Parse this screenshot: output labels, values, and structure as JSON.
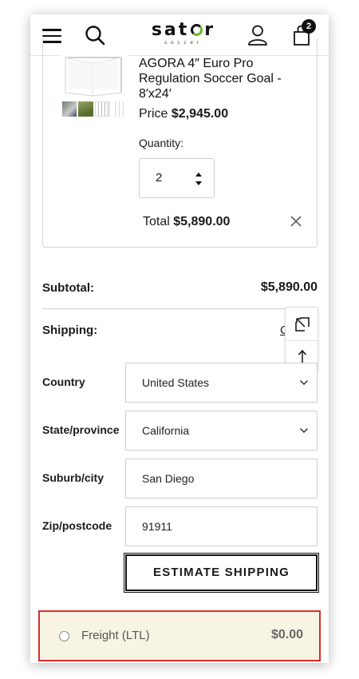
{
  "header": {
    "logo_text": "sator",
    "logo_sub": "soccer",
    "cart_count": "2"
  },
  "item": {
    "title": "AGORA 4″ Euro Pro Regulation Soccer Goal - 8′x24′",
    "price_label": "Price",
    "price_value": "$2,945.00",
    "quantity_label": "Quantity:",
    "quantity_value": "2",
    "total_label": "Total",
    "total_value": "$5,890.00"
  },
  "summary": {
    "subtotal_label": "Subtotal:",
    "subtotal_value": "$5,890.00",
    "shipping_label": "Shipping:",
    "shipping_link": "C"
  },
  "shipping_form": {
    "country_label": "Country",
    "country_value": "United States",
    "state_label": "State/province",
    "state_value": "California",
    "city_label": "Suburb/city",
    "city_value": "San Diego",
    "zip_label": "Zip/postcode",
    "zip_value": "91911",
    "estimate_button": "ESTIMATE SHIPPING"
  },
  "shipping_option": {
    "label": "Freight (LTL)",
    "price": "$0.00",
    "highlight_color": "#d62f2f"
  },
  "icons": [
    "menu-icon",
    "search-icon",
    "account-icon",
    "cart-icon",
    "close-icon",
    "expand-icon",
    "arrow-up-icon",
    "chevron-down-icon",
    "quantity-arrows-icon"
  ]
}
